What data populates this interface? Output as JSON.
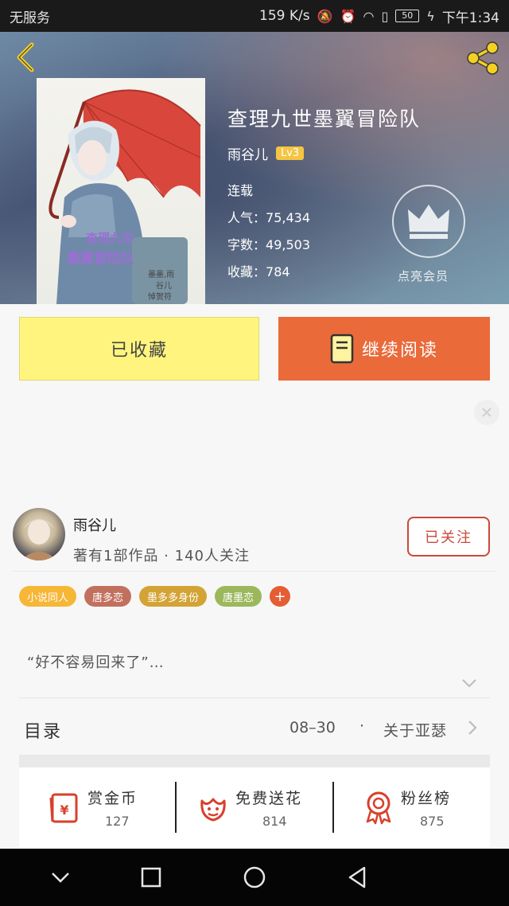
{
  "status_bar": {
    "carrier": "无服务",
    "net_speed": "159 K/s",
    "battery": "50",
    "time": "下午1:34"
  },
  "book": {
    "title": "查理九世墨翼冒险队",
    "author": "雨谷儿",
    "level": "Lv3",
    "state": "连载",
    "popularity_label": "人气：",
    "popularity": "75,434",
    "words_label": "字数：",
    "words": "49,503",
    "favorites_label": "收藏：",
    "favorites": "784",
    "cover_title": "查理九世 墨翼冒险队",
    "cover_credits": [
      "墨墨,雨",
      "谷儿",
      "悼贺符"
    ]
  },
  "vip": {
    "label": "点亮会员"
  },
  "actions": {
    "favorited_label": "已收藏",
    "continue_label": "继续阅读"
  },
  "author_block": {
    "name": "雨谷儿",
    "stats": "著有1部作品 · 140人关注",
    "follow_label": "已关注"
  },
  "tags": [
    {
      "label": "小说同人",
      "color": "#f6b636"
    },
    {
      "label": "唐多恋",
      "color": "#c2705e"
    },
    {
      "label": "墨多多身份",
      "color": "#d3a335"
    },
    {
      "label": "唐墨恋",
      "color": "#9cb85c"
    }
  ],
  "synopsis": "“好不容易回来了”…",
  "toc": {
    "title": "目录",
    "date": "08–30",
    "separator": "·",
    "latest_chapter": "关于亚瑟"
  },
  "stats": [
    {
      "label": "赏金币",
      "value": "127",
      "icon": "red-envelope-icon"
    },
    {
      "label": "免费送花",
      "value": "814",
      "icon": "flower-icon"
    },
    {
      "label": "粉丝榜",
      "value": "875",
      "icon": "medal-icon"
    }
  ],
  "colors": {
    "accent_orange": "#ea6a3a",
    "favorite_yellow": "#fff57e",
    "follow_red": "#c94a3a",
    "level_gold": "#f5c542",
    "icon_red": "#d8402b"
  }
}
